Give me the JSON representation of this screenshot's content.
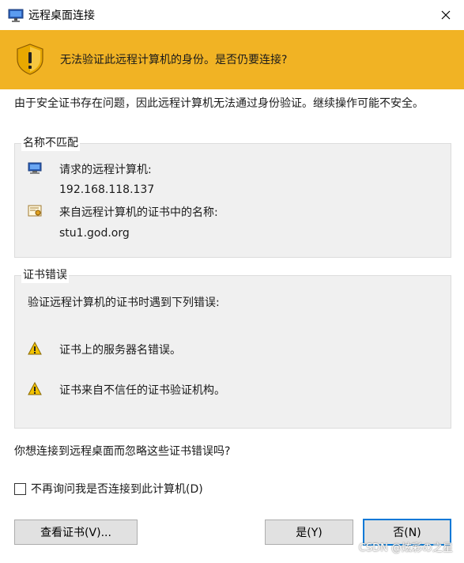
{
  "titlebar": {
    "title": "远程桌面连接",
    "close_icon": "close-icon"
  },
  "banner": {
    "message": "无法验证此远程计算机的身份。是否仍要连接?"
  },
  "intro": "由于安全证书存在问题，因此远程计算机无法通过身份验证。继续操作可能不安全。",
  "name_mismatch": {
    "legend": "名称不匹配",
    "requested_label": "请求的远程计算机:",
    "requested_value": "192.168.118.137",
    "cert_label": "来自远程计算机的证书中的名称:",
    "cert_value": "stu1.god.org"
  },
  "cert_errors": {
    "legend": "证书错误",
    "intro": "验证远程计算机的证书时遇到下列错误:",
    "errors": [
      "证书上的服务器名错误。",
      "证书来自不信任的证书验证机构。"
    ]
  },
  "question": "你想连接到远程桌面而忽略这些证书错误吗?",
  "checkbox": {
    "label": "不再询问我是否连接到此计算机(D)",
    "checked": false
  },
  "buttons": {
    "view_cert": "查看证书(V)...",
    "yes": "是(Y)",
    "no": "否(N)"
  },
  "watermark": "CSDN @炫彩の之星",
  "colors": {
    "banner": "#f1b324",
    "default_button_border": "#0078d7"
  }
}
